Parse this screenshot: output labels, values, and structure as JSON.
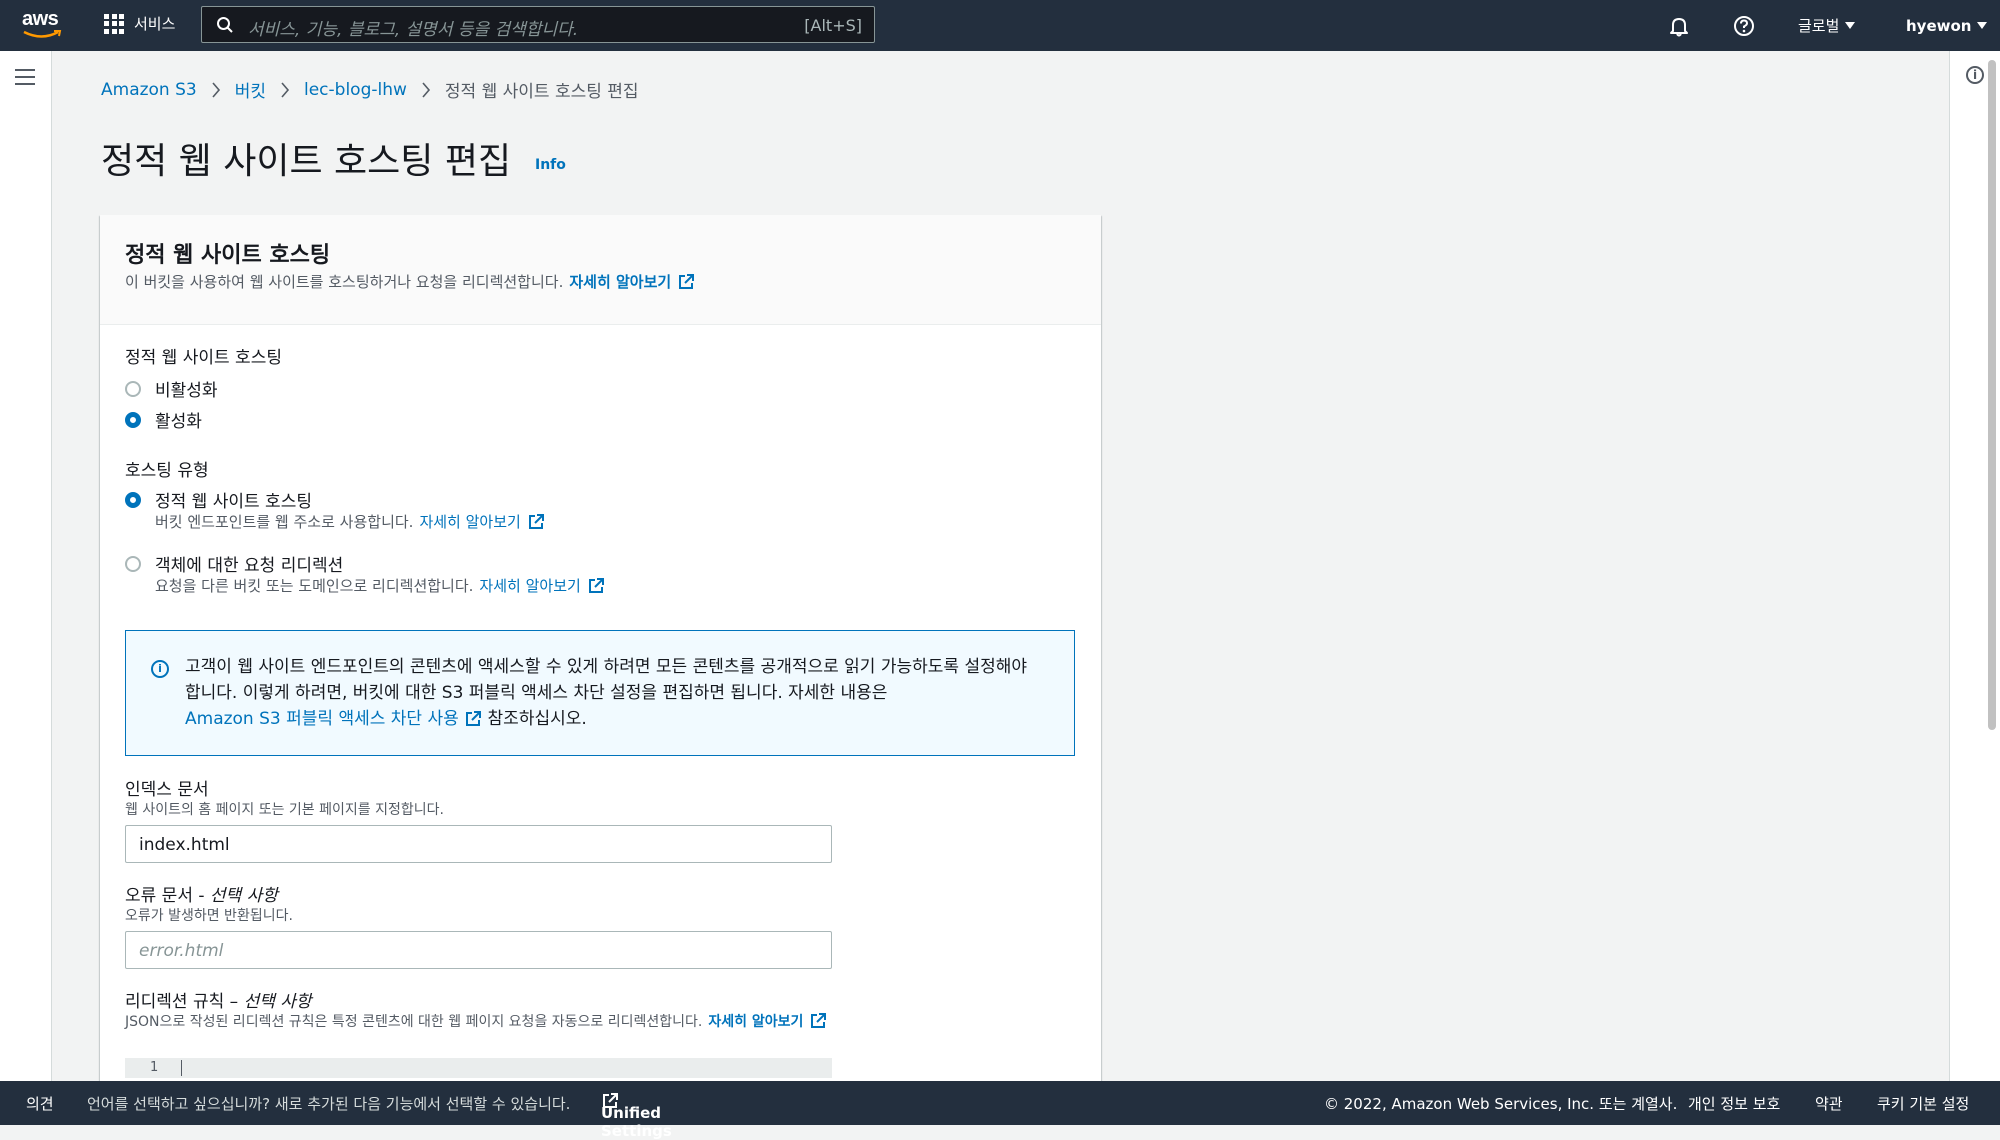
{
  "nav": {
    "logo": "aws",
    "services": "서비스",
    "search_placeholder": "서비스, 기능, 블로그, 설명서 등을 검색합니다.",
    "search_shortcut": "[Alt+S]",
    "region": "글로벌",
    "user": "hyewon"
  },
  "breadcrumb": {
    "items": [
      "Amazon S3",
      "버킷",
      "lec-blog-lhw"
    ],
    "current": "정적 웹 사이트 호스팅 편집"
  },
  "page": {
    "title": "정적 웹 사이트 호스팅 편집",
    "info": "Info"
  },
  "panel": {
    "title": "정적 웹 사이트 호스팅",
    "description": "이 버킷을 사용하여 웹 사이트를 호스팅하거나 요청을 리디렉션합니다.",
    "learn_more": "자세히 알아보기"
  },
  "hosting": {
    "label": "정적 웹 사이트 호스팅",
    "options": [
      "비활성화",
      "활성화"
    ],
    "selected": "활성화"
  },
  "hosting_type": {
    "label": "호스팅 유형",
    "options": [
      {
        "label": "정적 웹 사이트 호스팅",
        "desc": "버킷 엔드포인트를 웹 주소로 사용합니다.",
        "link": "자세히 알아보기"
      },
      {
        "label": "객체에 대한 요청 리디렉션",
        "desc": "요청을 다른 버킷 또는 도메인으로 리디렉션합니다.",
        "link": "자세히 알아보기"
      }
    ],
    "selected": "정적 웹 사이트 호스팅"
  },
  "alert": {
    "text1": "고객이 웹 사이트 엔드포인트의 콘텐츠에 액세스할 수 있게 하려면 모든 콘텐츠를 공개적으로 읽기 가능하도록 설정해야 합니다. 이렇게 하려면, 버킷에 대한 S3 퍼블릭 액세스 차단 설정을 편집하면 됩니다. 자세한 내용은",
    "link": "Amazon S3 퍼블릭 액세스 차단 사용",
    "text2": "참조하십시오."
  },
  "index_doc": {
    "label": "인덱스 문서",
    "desc": "웹 사이트의 홈 페이지 또는 기본 페이지를 지정합니다.",
    "value": "index.html"
  },
  "error_doc": {
    "label": "오류 문서 - ",
    "optional": "선택 사항",
    "desc": "오류가 발생하면 반환됩니다.",
    "placeholder": "error.html"
  },
  "redirect_rules": {
    "label": "리디렉션 규칙 – ",
    "optional": "선택 사항",
    "desc": "JSON으로 작성된 리디렉션 규칙은 특정 콘텐츠에 대한 웹 페이지 요청을 자동으로 리디렉션합니다.",
    "link": "자세히 알아보기",
    "line_number": "1"
  },
  "footer": {
    "feedback": "의견",
    "language_msg": "언어를 선택하고 싶으십니까? 새로 추가된 다음 기능에서 선택할 수 있습니다.",
    "unified_settings": "Unified Settings",
    "copyright": "© 2022, Amazon Web Services, Inc. 또는 계열사.",
    "privacy": "개인 정보 보호",
    "terms": "약관",
    "cookies": "쿠키 기본 설정"
  },
  "colors": {
    "nav_bg": "#232f3e",
    "link": "#0073bb",
    "alert_bg": "#f1faff",
    "page_bg": "#f2f3f3"
  }
}
